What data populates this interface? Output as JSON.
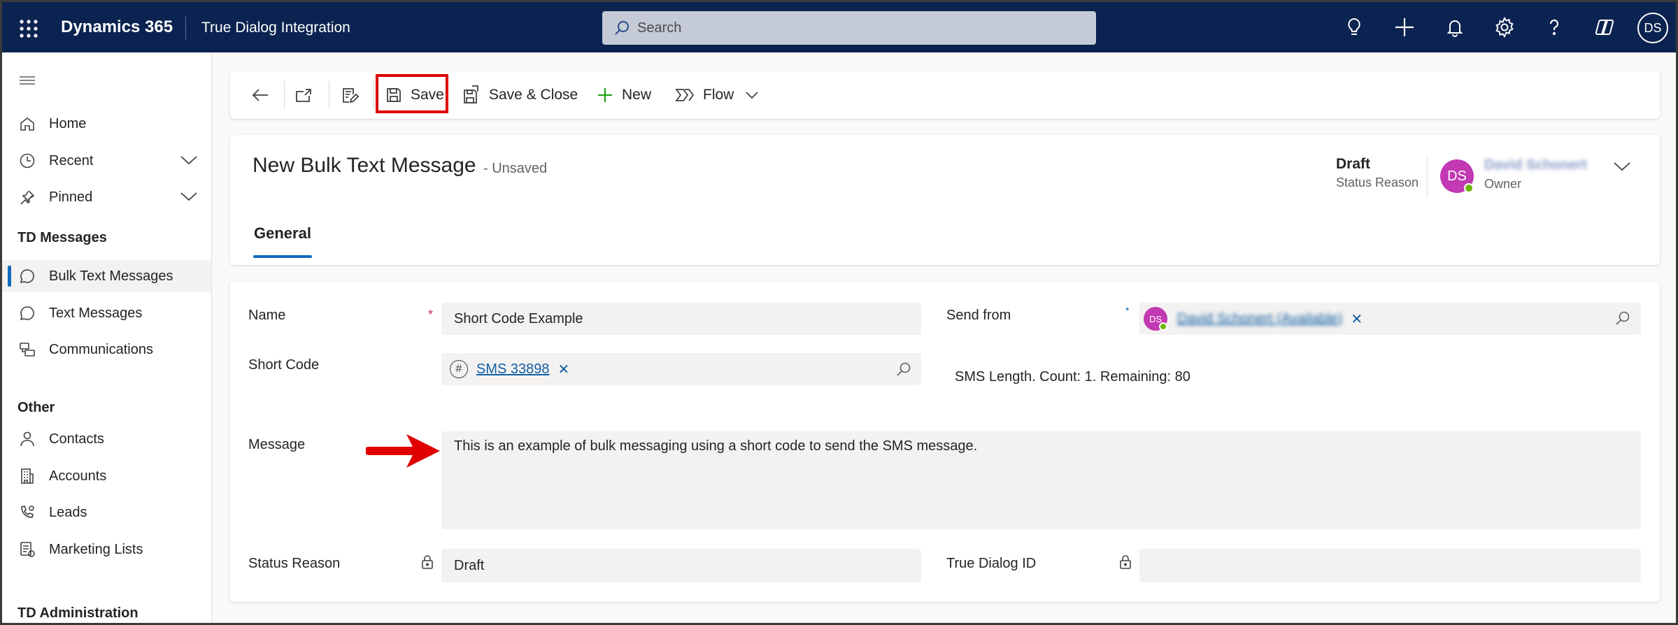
{
  "topbar": {
    "brand": "Dynamics 365",
    "app_name": "True Dialog Integration",
    "search_placeholder": "Search",
    "user_initials": "DS",
    "colors": {
      "background": "#0b2350"
    }
  },
  "sidebar": {
    "items": [
      {
        "label": "Home",
        "icon": "home-icon"
      },
      {
        "label": "Recent",
        "icon": "clock-icon"
      },
      {
        "label": "Pinned",
        "icon": "pin-icon"
      }
    ],
    "groups": [
      {
        "title": "TD Messages",
        "items": [
          {
            "label": "Bulk Text Messages",
            "icon": "chat-icon",
            "active": true
          },
          {
            "label": "Text Messages",
            "icon": "chat-icon"
          },
          {
            "label": "Communications",
            "icon": "communications-icon"
          }
        ]
      },
      {
        "title": "Other",
        "items": [
          {
            "label": "Contacts",
            "icon": "person-icon"
          },
          {
            "label": "Accounts",
            "icon": "building-icon"
          },
          {
            "label": "Leads",
            "icon": "phone-person-icon"
          },
          {
            "label": "Marketing Lists",
            "icon": "list-icon"
          }
        ]
      },
      {
        "title": "TD Administration",
        "items": []
      }
    ]
  },
  "commandbar": {
    "save": "Save",
    "save_close": "Save & Close",
    "new": "New",
    "flow": "Flow"
  },
  "header": {
    "title": "New Bulk Text Message",
    "unsaved": "- Unsaved",
    "status_value": "Draft",
    "status_label": "Status Reason",
    "owner_initials": "DS",
    "owner_name": "David Schonert",
    "owner_label": "Owner",
    "tab": "General"
  },
  "form": {
    "name_label": "Name",
    "name_value": "Short Code Example",
    "send_from_label": "Send from",
    "send_from_initials": "DS",
    "send_from_value": "David Schonert (Available)",
    "short_code_label": "Short Code",
    "short_code_value": "SMS 33898",
    "sms_length": "SMS Length. Count: 1. Remaining: 80",
    "message_label": "Message",
    "message_value": "This is an example of bulk messaging using a short code to send the SMS message.",
    "status_reason_label": "Status Reason",
    "status_reason_value": "Draft",
    "true_dialog_id_label": "True Dialog ID",
    "true_dialog_id_value": ""
  }
}
